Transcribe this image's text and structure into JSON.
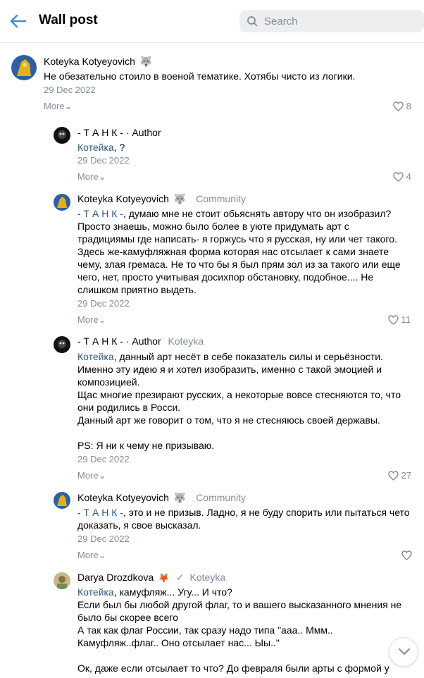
{
  "header": {
    "title": "Wall post",
    "search_placeholder": "Search"
  },
  "top_peek": {
    "more": "More",
    "likes": "8"
  },
  "comments": [
    {
      "author": "Koteyka Kotyeyovich",
      "tag": "",
      "reply_to": "",
      "mention": "",
      "text": "Не обезательно стоило в военой тематике. Хотябы чисто из логики.",
      "date": "29 Dec 2022",
      "more": "More",
      "likes": "8"
    },
    {
      "author": "- Т А Н К - · Author",
      "tag": "",
      "reply_to": "",
      "mention": "Котейка",
      "text": ", ?",
      "date": "29 Dec 2022",
      "more": "More",
      "likes": "4"
    },
    {
      "author": "Koteyka Kotyeyovich",
      "tag": "Community",
      "reply_to": "",
      "mention": "- Т А Н К -",
      "text": ", думаю мне не стоит обьяснять автору что он изобразил?\nПросто знаешь, можно было более в уюте придумать арт с\nтрадициямы где написать- я горжусь что я русская, ну или чет такого.\nЗдесь же-камуфляжная форма которая нас отсылает к сами знаете\nчему, злая гремаса. Не то что бы я был прям зол из за такого или еще\nчего, нет, просто учитывая досихпор обстановку, подобное.... Не\nслишком приятно выдеть.",
      "date": "29 Dec 2022",
      "more": "More",
      "likes": "11"
    },
    {
      "author": "- Т А Н К - · Author",
      "tag": "Koteyka",
      "reply_to": "",
      "mention": "Котейка",
      "text": ", данный арт несёт в себе показатель силы и серьёзности.\nИменно эту идею я и хотел изобразить, именно с такой эмоцией и\nкомпозицией.\nЩас многие презирают русских, а некоторые вовсе стесняются то, что\nони родились в Росси.\nДанный арт же говорит о том, что я не стесняюсь своей державы.\n\nPS: Я ни к чему не призываю.",
      "date": "29 Dec 2022",
      "more": "More",
      "likes": "27"
    },
    {
      "author": "Koteyka Kotyeyovich",
      "tag": "Community",
      "reply_to": "",
      "mention": "- Т А Н К -",
      "text": ", это и не призыв. Ладно, я не буду спорить или пытаться чето\nдоказать, я свое высказал.",
      "date": "29 Dec 2022",
      "more": "More",
      "likes": ""
    },
    {
      "author": "Darya Drozdkova",
      "tag": "Koteyka",
      "reply_to": "",
      "mention": "Котейка",
      "text": ", камуфляж... Угу... И что?\nЕсли был бы любой другой флаг, то и вашего высказанного мнения не\nбыло бы скорее всего\nА так как флаг России, так сразу надо типа \"ааа.. Ммм..\nКамуфляж..флаг.. Оно отсылает нас... Ыы..\"\n\nОк, даже если отсылает то что? До февраля были арты с формой у",
      "date": "",
      "more": "",
      "likes": ""
    }
  ],
  "colors": {
    "link": "#2a5885",
    "muted": "#818c99",
    "accent": "#3f8ae0"
  }
}
